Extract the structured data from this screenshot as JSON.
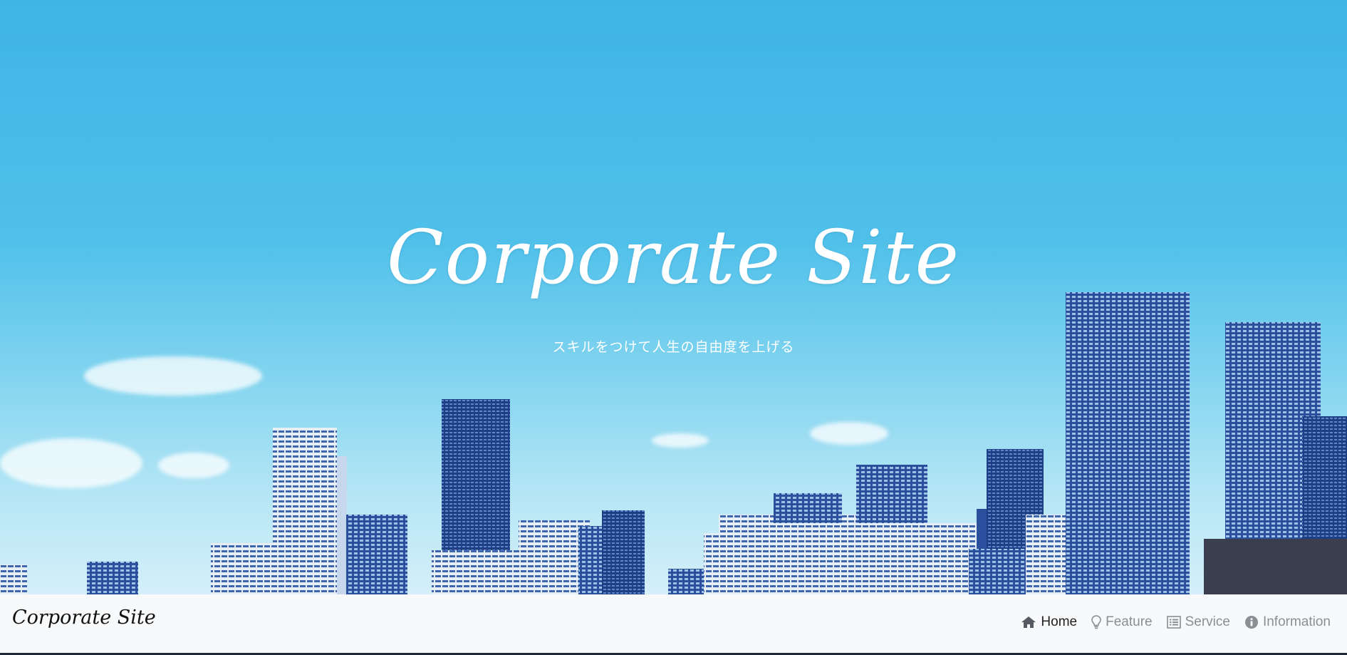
{
  "hero": {
    "title": "Corporate Site",
    "subtitle": "スキルをつけて人生の自由度を上げる"
  },
  "navbar": {
    "brand": "Corporate Site",
    "items": [
      {
        "label": "Home",
        "icon": "home-icon",
        "active": true
      },
      {
        "label": "Feature",
        "icon": "lightbulb-icon",
        "active": false
      },
      {
        "label": "Service",
        "icon": "list-icon",
        "active": false
      },
      {
        "label": "Information",
        "icon": "info-circle-icon",
        "active": false
      }
    ]
  },
  "colors": {
    "sky": "#4fc0ea",
    "navbar_bg": "#f8f9fa",
    "nav_active": "#222222",
    "nav_inactive": "#8a8f94"
  }
}
